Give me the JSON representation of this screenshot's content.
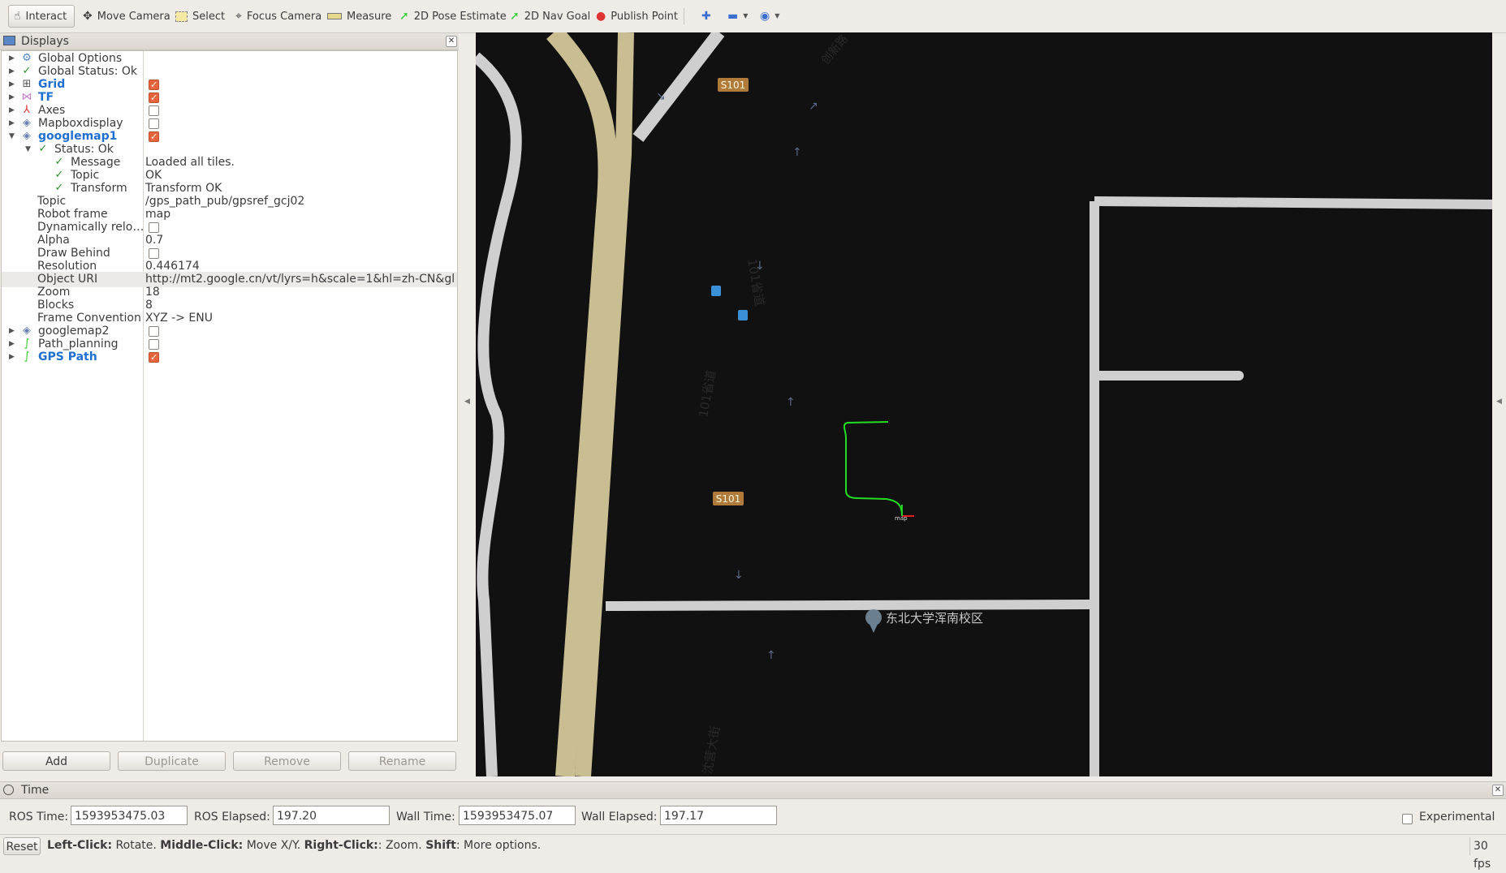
{
  "toolbar": {
    "tools": [
      {
        "label": "Interact",
        "icon": "hand-pointer-icon"
      },
      {
        "label": "Move Camera",
        "icon": "move-camera-icon"
      },
      {
        "label": "Select",
        "icon": "select-box-icon"
      },
      {
        "label": "Focus Camera",
        "icon": "crosshair-icon"
      },
      {
        "label": "Measure",
        "icon": "ruler-icon"
      },
      {
        "label": "2D Pose Estimate",
        "icon": "pose-arrow-icon"
      },
      {
        "label": "2D Nav Goal",
        "icon": "nav-arrow-icon"
      },
      {
        "label": "Publish Point",
        "icon": "map-pin-icon"
      }
    ],
    "active": "Interact"
  },
  "displays": {
    "title": "Displays",
    "rows": [
      {
        "name": "Global Options"
      },
      {
        "name": "Global Status: Ok"
      },
      {
        "name": "Grid"
      },
      {
        "name": "TF"
      },
      {
        "name": "Axes"
      },
      {
        "name": "Mapboxdisplay"
      },
      {
        "name": "googlemap1"
      },
      {
        "name": "Status: Ok"
      },
      {
        "name": "Message",
        "value": "Loaded all tiles."
      },
      {
        "name": "Topic",
        "value": "OK"
      },
      {
        "name": "Transform",
        "value": "Transform OK"
      },
      {
        "name": "Topic",
        "value": "/gps_path_pub/gpsref_gcj02"
      },
      {
        "name": "Robot frame",
        "value": "map"
      },
      {
        "name": "Dynamically relo…"
      },
      {
        "name": "Alpha",
        "value": "0.7"
      },
      {
        "name": "Draw Behind"
      },
      {
        "name": "Resolution",
        "value": "0.446174"
      },
      {
        "name": "Object URI",
        "value": "http://mt2.google.cn/vt/lyrs=h&scale=1&hl=zh-CN&gl…"
      },
      {
        "name": "Zoom",
        "value": "18"
      },
      {
        "name": "Blocks",
        "value": "8"
      },
      {
        "name": "Frame Convention",
        "value": "XYZ -> ENU"
      },
      {
        "name": "googlemap2"
      },
      {
        "name": "Path_planning"
      },
      {
        "name": "GPS Path"
      }
    ],
    "checkboxes": {
      "Grid": true,
      "TF": true,
      "Axes": false,
      "Mapboxdisplay": false,
      "googlemap1": true,
      "Dynamically relo…": false,
      "Draw Behind": false,
      "googlemap2": false,
      "Path_planning": false,
      "GPS Path": true
    },
    "buttons": {
      "add": "Add",
      "duplicate": "Duplicate",
      "remove": "Remove",
      "rename": "Rename"
    }
  },
  "map": {
    "labels": {
      "s101_top": "S101",
      "s101_mid": "S101",
      "road_101_a": "101省道",
      "road_101_b": "101省道",
      "road_bottom": "沈营大街",
      "road_top_right": "创新路",
      "poi": "东北大学浑南校区",
      "frame": "map"
    },
    "colors": {
      "background": "#111111",
      "major_road": "#c9bd92",
      "minor_road": "#cfcfcf",
      "path": "#22dd22"
    }
  },
  "time": {
    "title": "Time",
    "ros_time_label": "ROS Time:",
    "ros_time": "1593953475.03",
    "ros_elapsed_label": "ROS Elapsed:",
    "ros_elapsed": "197.20",
    "wall_time_label": "Wall Time:",
    "wall_time": "1593953475.07",
    "wall_elapsed_label": "Wall Elapsed:",
    "wall_elapsed": "197.17",
    "experimental_label": "Experimental"
  },
  "status": {
    "reset": "Reset",
    "hint_parts": [
      {
        "b": "Left-Click:",
        "t": " Rotate. "
      },
      {
        "b": "Middle-Click:",
        "t": " Move X/Y. "
      },
      {
        "b": "Right-Click:",
        "t": ": Zoom. "
      },
      {
        "b": "Shift",
        "t": ": More options."
      }
    ],
    "fps": "30 fps"
  }
}
